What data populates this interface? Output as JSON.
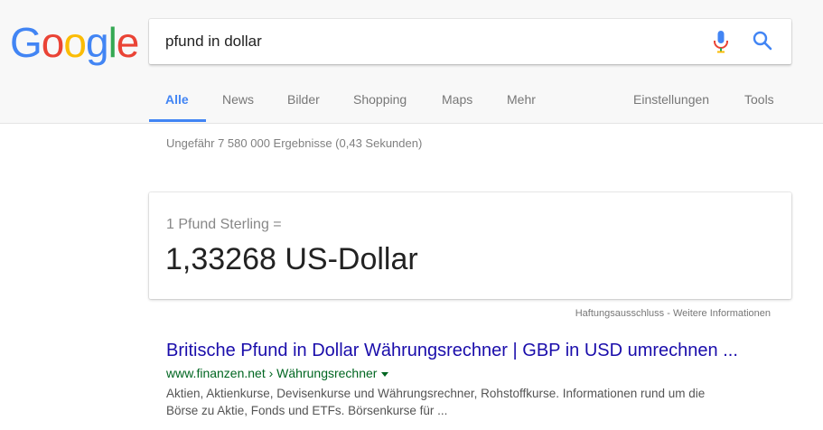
{
  "logo": {
    "letters": [
      "G",
      "o",
      "o",
      "g",
      "l",
      "e"
    ],
    "colors": [
      "#4285F4",
      "#EA4335",
      "#FBBC05",
      "#4285F4",
      "#34A853",
      "#EA4335"
    ]
  },
  "search": {
    "query": "pfund in dollar"
  },
  "tabs": [
    {
      "label": "Alle",
      "active": true
    },
    {
      "label": "News"
    },
    {
      "label": "Bilder"
    },
    {
      "label": "Shopping"
    },
    {
      "label": "Maps"
    },
    {
      "label": "Mehr"
    },
    {
      "label": "Einstellungen"
    },
    {
      "label": "Tools"
    }
  ],
  "stats": "Ungefähr 7 580 000 Ergebnisse (0,43 Sekunden)",
  "converter": {
    "from": "1 Pfund Sterling =",
    "to": "1,33268 US-Dollar"
  },
  "disclaimer": {
    "left": "Haftungsausschluss",
    "separator": " - ",
    "right": "Weitere Informationen"
  },
  "result": {
    "title": "Britische Pfund in Dollar Währungsrechner | GBP in USD umrechnen ...",
    "url": "www.finanzen.net › Währungsrechner",
    "snippet_line1": "Aktien, Aktienkurse, Devisenkurse und Währungsrechner, Rohstoffkurse. Informationen rund um die",
    "snippet_line2": "Börse zu Aktie, Fonds und ETFs. Börsenkurse für ..."
  },
  "icons": {
    "mic": "microphone-icon",
    "search": "search-icon"
  },
  "accent": "#4285F4"
}
